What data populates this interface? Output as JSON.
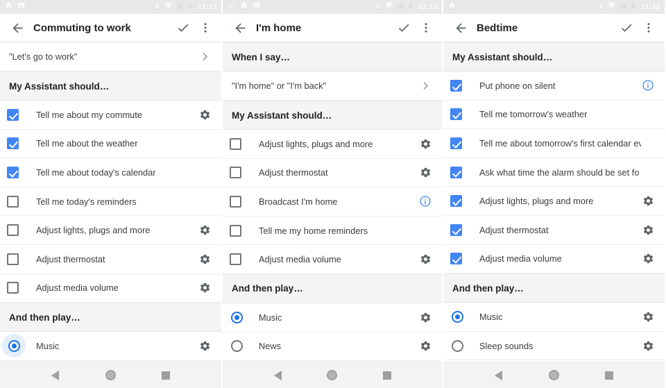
{
  "panels": [
    {
      "status_bar": {
        "time": "11:12",
        "left_icons": [
          "home-icon",
          "image-icon"
        ],
        "right_icons": [
          "bluetooth-icon",
          "wifi-icon",
          "signal-off-icon",
          "battery-icon"
        ]
      },
      "app_bar": {
        "back_label": "back-arrow",
        "title": "Commuting to work",
        "confirm_label": "check",
        "overflow_label": "more-options"
      },
      "sections": [
        {
          "type": "phrase",
          "rows": [
            {
              "label": "\"Let's go to work\"",
              "tail": "chevron-right-icon"
            }
          ]
        },
        {
          "type": "checkbox",
          "header": "My Assistant should…",
          "rows": [
            {
              "label": "Tell me about my commute",
              "checked": true,
              "tail": "gear-icon"
            },
            {
              "label": "Tell me about the weather",
              "checked": true,
              "tail": "none"
            },
            {
              "label": "Tell me about today's calendar",
              "checked": true,
              "tail": "none"
            },
            {
              "label": "Tell me today's reminders",
              "checked": false,
              "tail": "none"
            },
            {
              "label": "Adjust lights, plugs and more",
              "checked": false,
              "tail": "gear-icon"
            },
            {
              "label": "Adjust thermostat",
              "checked": false,
              "tail": "gear-icon"
            },
            {
              "label": "Adjust media volume",
              "checked": false,
              "tail": "gear-icon"
            }
          ]
        },
        {
          "type": "radio",
          "header": "And then play…",
          "rows": [
            {
              "label": "Music",
              "selected": true,
              "ripple": true,
              "tail": "gear-icon"
            }
          ]
        }
      ],
      "nav_bar": {
        "back": "back-triangle-icon",
        "home": "home-circle-icon",
        "recents": "recents-square-icon"
      }
    },
    {
      "status_bar": {
        "time": "11:12",
        "left_icons": [
          "sync-icon",
          "home-icon",
          "image-icon"
        ],
        "right_icons": [
          "bluetooth-icon",
          "wifi-icon",
          "signal-off-icon",
          "battery-icon"
        ]
      },
      "app_bar": {
        "back_label": "back-arrow",
        "title": "I'm home",
        "confirm_label": "check",
        "overflow_label": "more-options"
      },
      "sections": [
        {
          "type": "phrase",
          "header": "When I say…",
          "rows": [
            {
              "label": "\"I'm home\" or \"I'm back\"",
              "tail": "chevron-right-icon"
            }
          ]
        },
        {
          "type": "checkbox",
          "header": "My Assistant should…",
          "rows": [
            {
              "label": "Adjust lights, plugs and more",
              "checked": false,
              "tail": "gear-icon"
            },
            {
              "label": "Adjust thermostat",
              "checked": false,
              "tail": "gear-icon"
            },
            {
              "label": "Broadcast I'm home",
              "checked": false,
              "tail": "info-icon"
            },
            {
              "label": "Tell me my home reminders",
              "checked": false,
              "tail": "none"
            },
            {
              "label": "Adjust media volume",
              "checked": false,
              "tail": "gear-icon"
            }
          ]
        },
        {
          "type": "radio",
          "header": "And then play…",
          "rows": [
            {
              "label": "Music",
              "selected": true,
              "ripple": false,
              "tail": "gear-icon"
            },
            {
              "label": "News",
              "selected": false,
              "ripple": false,
              "tail": "gear-icon"
            }
          ]
        }
      ],
      "nav_bar": {
        "back": "back-triangle-icon",
        "home": "home-circle-icon",
        "recents": "recents-square-icon"
      }
    },
    {
      "status_bar": {
        "time": "11:12",
        "left_icons": [
          "home-icon"
        ],
        "right_icons": [
          "bluetooth-icon",
          "wifi-icon",
          "signal-off-icon",
          "battery-icon"
        ]
      },
      "app_bar": {
        "back_label": "back-arrow",
        "title": "Bedtime",
        "confirm_label": "check",
        "overflow_label": "more-options"
      },
      "sections": [
        {
          "type": "checkbox",
          "header": "My Assistant should…",
          "rows": [
            {
              "label": "Put phone on silent",
              "checked": true,
              "tail": "info-icon"
            },
            {
              "label": "Tell me tomorrow's weather",
              "checked": true,
              "tail": "none"
            },
            {
              "label": "Tell me about tomorrow's first calendar event",
              "checked": true,
              "tail": "none"
            },
            {
              "label": "Ask what time the alarm should be set for",
              "checked": true,
              "tail": "none"
            },
            {
              "label": "Adjust lights, plugs and more",
              "checked": true,
              "tail": "gear-icon"
            },
            {
              "label": "Adjust thermostat",
              "checked": true,
              "tail": "gear-icon"
            },
            {
              "label": "Adjust media volume",
              "checked": true,
              "tail": "gear-icon"
            }
          ]
        },
        {
          "type": "radio",
          "header": "And then play…",
          "rows": [
            {
              "label": "Music",
              "selected": true,
              "ripple": false,
              "tail": "gear-icon"
            },
            {
              "label": "Sleep sounds",
              "selected": false,
              "ripple": false,
              "tail": "gear-icon"
            }
          ]
        }
      ],
      "nav_bar": {
        "back": "back-triangle-icon",
        "home": "home-circle-icon",
        "recents": "recents-square-icon"
      }
    }
  ],
  "colors": {
    "accent_blue": "#4285f4",
    "radio_blue": "#1a73e8",
    "section_bg": "#f4f4f4",
    "status_bar_bg": "#e8e8e8",
    "nav_bar_bg": "#f3f3f3"
  }
}
